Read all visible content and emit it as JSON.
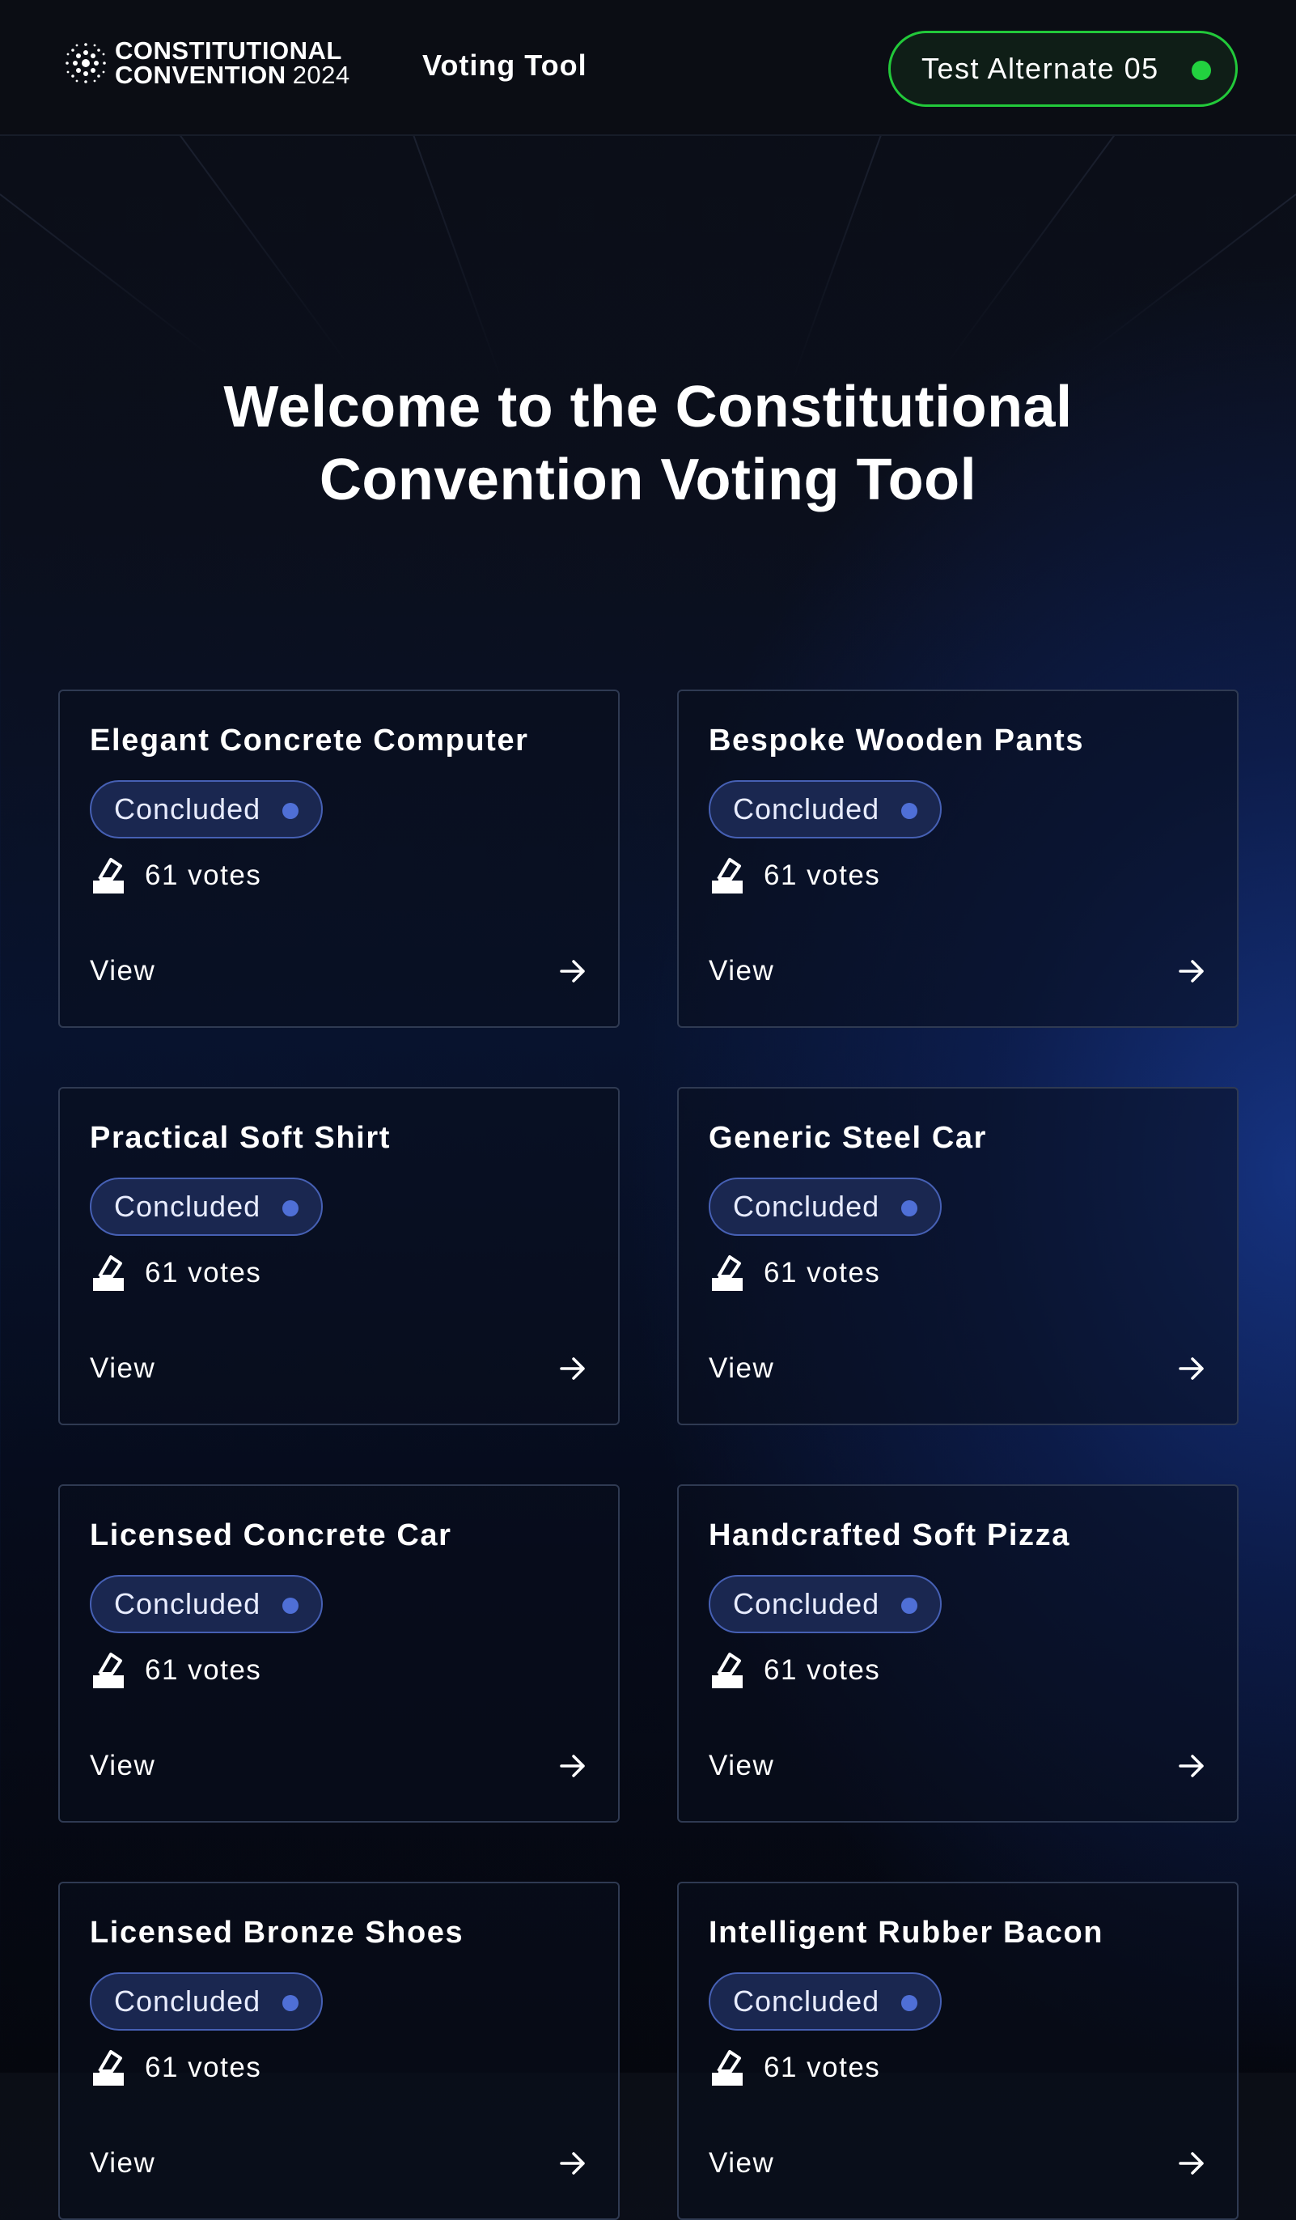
{
  "header": {
    "logo_line1": "CONSTITUTIONAL",
    "logo_line2_bold": "CONVENTION",
    "logo_line2_year": "2024",
    "app_title": "Voting Tool",
    "user_name": "Test Alternate 05",
    "user_status_color": "#22d13f"
  },
  "hero": {
    "title_line1": "Welcome to the Constitutional",
    "title_line2": "Convention Voting Tool"
  },
  "colors": {
    "accent_green": "#22c93a",
    "badge_border": "#4660b4",
    "badge_dot": "#4f6fd6"
  },
  "proposals": [
    {
      "title": "Elegant Concrete Computer",
      "status": "Concluded",
      "votes": "61 votes",
      "action": "View"
    },
    {
      "title": "Bespoke Wooden Pants",
      "status": "Concluded",
      "votes": "61 votes",
      "action": "View"
    },
    {
      "title": "Practical Soft Shirt",
      "status": "Concluded",
      "votes": "61 votes",
      "action": "View"
    },
    {
      "title": "Generic Steel Car",
      "status": "Concluded",
      "votes": "61 votes",
      "action": "View"
    },
    {
      "title": "Licensed Concrete Car",
      "status": "Concluded",
      "votes": "61 votes",
      "action": "View"
    },
    {
      "title": "Handcrafted Soft Pizza",
      "status": "Concluded",
      "votes": "61 votes",
      "action": "View"
    },
    {
      "title": "Licensed Bronze Shoes",
      "status": "Concluded",
      "votes": "61 votes",
      "action": "View"
    },
    {
      "title": "Intelligent Rubber Bacon",
      "status": "Concluded",
      "votes": "61 votes",
      "action": "View"
    }
  ]
}
